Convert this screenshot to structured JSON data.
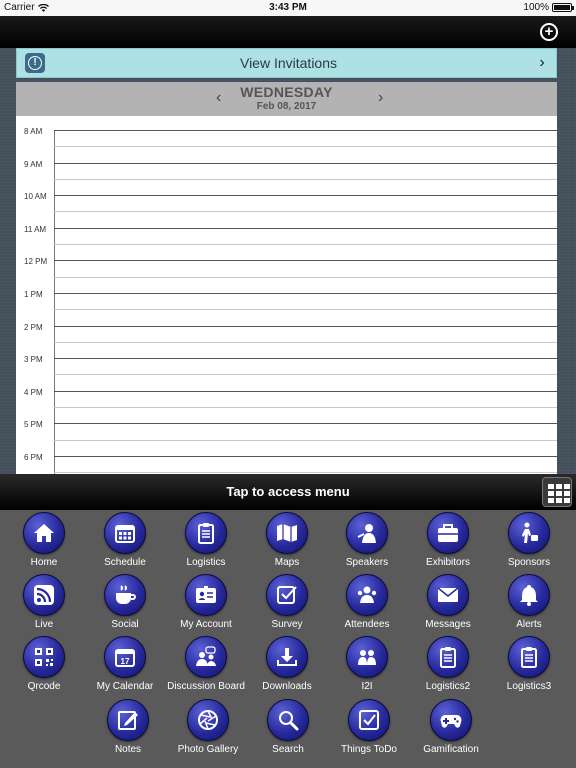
{
  "status_bar": {
    "carrier": "Carrier",
    "time": "3:43 PM",
    "battery": "100%"
  },
  "top_nav": {
    "add_icon": "plus-circle-icon"
  },
  "invitations": {
    "label": "View Invitations",
    "icon": "alert-icon"
  },
  "date_header": {
    "day": "WEDNESDAY",
    "date": "Feb 08, 2017"
  },
  "schedule": {
    "times": [
      "8 AM",
      "9 AM",
      "10 AM",
      "11 AM",
      "12 PM",
      "1 PM",
      "2 PM",
      "3 PM",
      "4 PM",
      "5 PM",
      "6 PM"
    ]
  },
  "menu_bar": {
    "label": "Tap to access menu"
  },
  "menu": {
    "items": [
      {
        "label": "Home",
        "icon": "home-icon"
      },
      {
        "label": "Schedule",
        "icon": "calendar-icon"
      },
      {
        "label": "Logistics",
        "icon": "clipboard-icon"
      },
      {
        "label": "Maps",
        "icon": "map-icon"
      },
      {
        "label": "Speakers",
        "icon": "speaker-icon"
      },
      {
        "label": "Exhibitors",
        "icon": "briefcase-icon"
      },
      {
        "label": "Sponsors",
        "icon": "sponsor-icon"
      },
      {
        "label": "Live",
        "icon": "rss-icon"
      },
      {
        "label": "Social",
        "icon": "coffee-icon"
      },
      {
        "label": "My Account",
        "icon": "id-card-icon"
      },
      {
        "label": "Survey",
        "icon": "checkbox-icon"
      },
      {
        "label": "Attendees",
        "icon": "people-icon"
      },
      {
        "label": "Messages",
        "icon": "envelope-icon"
      },
      {
        "label": "Alerts",
        "icon": "bell-icon"
      },
      {
        "label": "Qrcode",
        "icon": "qrcode-icon"
      },
      {
        "label": "My Calendar",
        "icon": "calendar-day-icon"
      },
      {
        "label": "Discussion Board",
        "icon": "discussion-icon"
      },
      {
        "label": "Downloads",
        "icon": "download-icon"
      },
      {
        "label": "I2I",
        "icon": "two-people-icon"
      },
      {
        "label": "Logistics2",
        "icon": "clipboard-icon"
      },
      {
        "label": "Logistics3",
        "icon": "clipboard-icon"
      },
      {
        "label": "Notes",
        "icon": "pencil-icon"
      },
      {
        "label": "Photo Gallery",
        "icon": "aperture-icon"
      },
      {
        "label": "Search",
        "icon": "search-icon"
      },
      {
        "label": "Things ToDo",
        "icon": "check-square-icon"
      },
      {
        "label": "Gamification",
        "icon": "gamepad-icon"
      }
    ]
  },
  "colors": {
    "menu_circle": "#27299b",
    "invite_bg": "#aee1e3",
    "header_bg": "#b3b3b3"
  }
}
